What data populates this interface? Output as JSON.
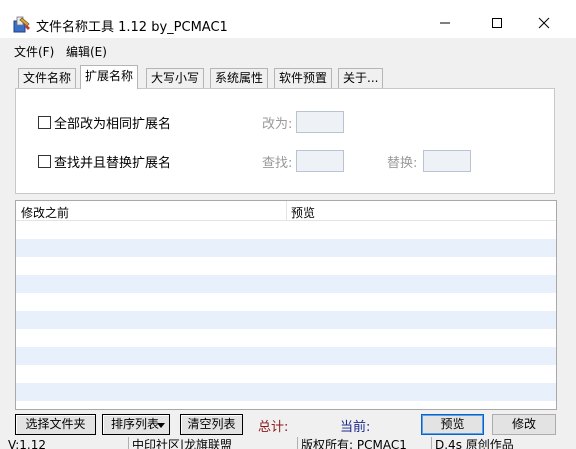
{
  "window": {
    "title": "文件名称工具 1.12  by_PCMAC1",
    "minimize_glyph": "—",
    "maximize_glyph": "☐",
    "close_glyph": "✕"
  },
  "menu": {
    "file": "文件(F)",
    "edit": "编辑(E)"
  },
  "tabs": [
    {
      "label": "文件名称",
      "active": false
    },
    {
      "label": "扩展名称",
      "active": true
    },
    {
      "label": "大写小写",
      "active": false
    },
    {
      "label": "系统属性",
      "active": false
    },
    {
      "label": "软件预置",
      "active": false
    },
    {
      "label": "关于...",
      "active": false
    }
  ],
  "panel": {
    "option1_label": "全部改为相同扩展名",
    "option1_checked": false,
    "change_to_label": "改为:",
    "change_to_value": "",
    "option2_label": "查找并且替换扩展名",
    "option2_checked": false,
    "find_label": "查找:",
    "find_value": "",
    "replace_label": "替换:",
    "replace_value": ""
  },
  "list": {
    "col_before": "修改之前",
    "col_preview": "预览",
    "stripe_color": "#e8f1fb"
  },
  "bottom": {
    "choose_files": "选择文件夹",
    "sort_list": "排序列表",
    "clear_list": "清空列表",
    "total": "总计:",
    "current": "当前:",
    "preview": "预览",
    "modify": "修改"
  },
  "status": {
    "version": "V:1.12",
    "forum": "中印社区|龙旗联盟",
    "copyright": "版权所有: PCMAC1",
    "author": "D.4s 原创作品"
  },
  "colors": {
    "total": "#8b1a1a",
    "current": "#1c2a8c",
    "accent": "#0a64c8"
  },
  "icons": {
    "app": "tools-icon",
    "sort": "dropdown-arrow-icon"
  }
}
